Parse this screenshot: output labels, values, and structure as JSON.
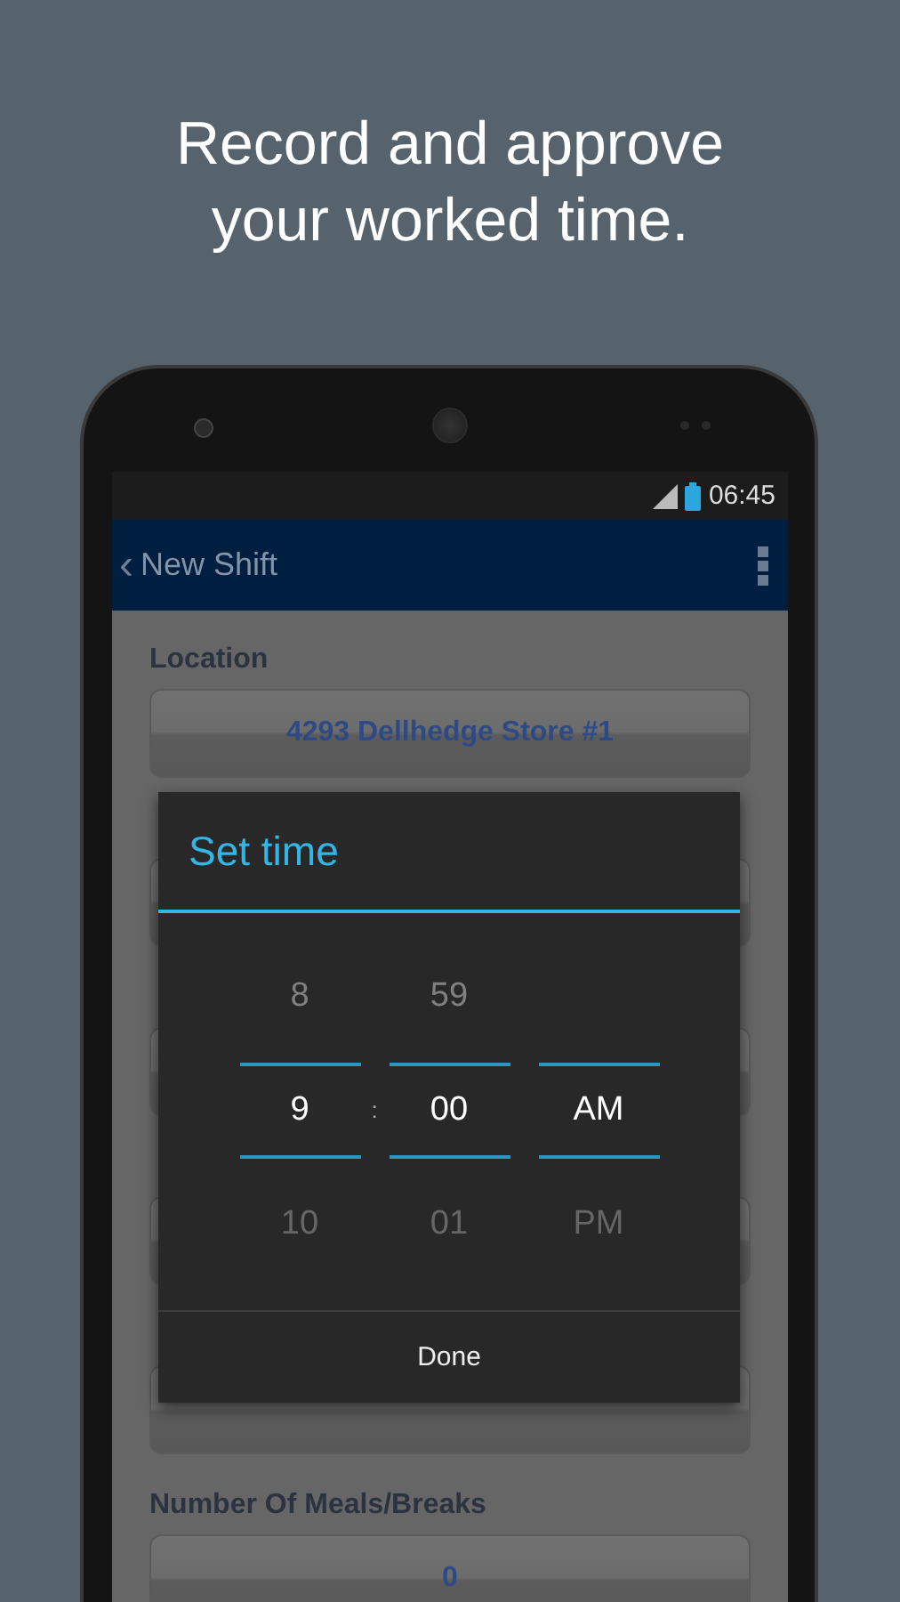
{
  "headline": "Record and approve your worked time.",
  "status_bar": {
    "time": "06:45"
  },
  "app_bar": {
    "back": "‹",
    "title": "New Shift"
  },
  "form": [
    {
      "kind": "labeled",
      "label": "Location",
      "value": "4293 Dellhedge Store #1"
    },
    {
      "kind": "covered"
    },
    {
      "kind": "covered"
    },
    {
      "kind": "covered"
    },
    {
      "kind": "covered"
    },
    {
      "kind": "labeled",
      "label": "Number Of Meals/Breaks",
      "value": "0"
    }
  ],
  "dialog": {
    "title": "Set time",
    "separator": ":",
    "columns": [
      {
        "above": "8",
        "current": "9",
        "below": "10"
      },
      {
        "above": "59",
        "current": "00",
        "below": "01"
      },
      {
        "current": "AM",
        "below": "PM"
      }
    ],
    "button": "Done"
  }
}
